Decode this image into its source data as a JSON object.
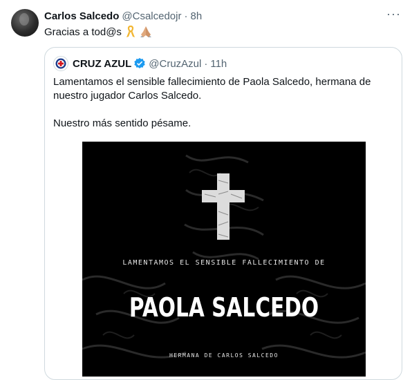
{
  "post": {
    "author_name": "Carlos Salcedo",
    "handle": "@Csalcedojr",
    "dot": "·",
    "time": "8h",
    "more": "···",
    "text": "Gracias a tod@s"
  },
  "quoted": {
    "author_name": "CRUZ AZUL",
    "handle": "@CruzAzul",
    "dot": "·",
    "time": "11h",
    "paragraph1": "Lamentamos el sensible fallecimiento de Paola Salcedo, hermana de nuestro jugador Carlos Salcedo.",
    "paragraph2": "Nuestro más sentido pésame.",
    "image": {
      "line1": "LAMENTAMOS EL SENSIBLE FALLECIMIENTO DE",
      "name": "PAOLA SALCEDO",
      "line3": "HERMANA DE CARLOS SALCEDO"
    }
  },
  "colors": {
    "verified": "#1d9bf0",
    "ribbon": "#f2b632",
    "cruz_azul_blue": "#1c3a8a",
    "cruz_azul_red": "#d2141d"
  },
  "icons": [
    "ribbon-icon",
    "praying-hands-icon",
    "verified-badge-icon",
    "more-options-icon",
    "cross-icon",
    "cruz-azul-logo-icon"
  ]
}
